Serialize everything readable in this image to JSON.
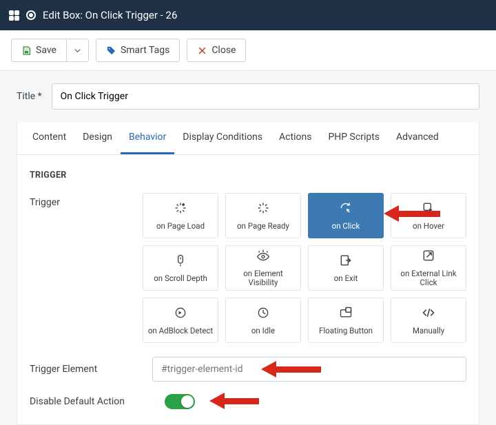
{
  "topbar": {
    "title": "Edit Box: On Click Trigger - 26"
  },
  "toolbar": {
    "save": "Save",
    "smartTags": "Smart Tags",
    "close": "Close"
  },
  "title": {
    "label": "Title *",
    "value": "On Click Trigger"
  },
  "tabs": [
    "Content",
    "Design",
    "Behavior",
    "Display Conditions",
    "Actions",
    "PHP Scripts",
    "Advanced"
  ],
  "activeTab": 2,
  "section": {
    "heading": "Trigger"
  },
  "trigger": {
    "label": "Trigger",
    "options": [
      "on Page Load",
      "on Page Ready",
      "on Click",
      "on Hover",
      "on Scroll Depth",
      "on Element Visibility",
      "on Exit",
      "on External Link Click",
      "on AdBlock Detect",
      "on Idle",
      "Floating Button",
      "Manually"
    ],
    "selectedIndex": 2
  },
  "triggerElement": {
    "label": "Trigger Element",
    "placeholder": "#trigger-element-id"
  },
  "disableDefault": {
    "label": "Disable Default Action",
    "value": true
  },
  "icons": {
    "pageLoad": "<svg viewBox='0 0 24 24' fill='none' stroke='currentColor' stroke-width='1.7'><line x1='12' y1='3' x2='12' y2='7'/><line x1='12' y1='17' x2='12' y2='21'/><line x1='3' y1='12' x2='7' y2='12'/><line x1='17' y1='12' x2='21' y2='12'/><line x1='5.6' y1='5.6' x2='8.3' y2='8.3'/><line x1='15.7' y1='15.7' x2='18.4' y2='18.4'/><line x1='5.6' y1='18.4' x2='8.3' y2='15.7'/><line x1='15.7' y1='8.3' x2='18.4' y2='5.6'/><circle cx='17' cy='6' r='2.2' fill='currentColor' stroke='none'/></svg>",
    "pageReady": "<svg viewBox='0 0 24 24' fill='none' stroke='currentColor' stroke-width='1.7'><line x1='12' y1='3' x2='12' y2='7'/><line x1='12' y1='17' x2='12' y2='21'/><line x1='3' y1='12' x2='7' y2='12'/><line x1='17' y1='12' x2='21' y2='12'/><line x1='5.6' y1='5.6' x2='8.3' y2='8.3'/><line x1='15.7' y1='15.7' x2='18.4' y2='18.4'/><line x1='5.6' y1='18.4' x2='8.3' y2='15.7'/><line x1='15.7' y1='8.3' x2='18.4' y2='5.6'/></svg>",
    "click": "<svg viewBox='0 0 24 24' fill='none' stroke='currentColor' stroke-width='1.7'><path d='M4 12a8 8 0 0 1 14-5'/><polyline points='18 3 18 7 14 7'/><path d='M13 13 l6 2 -2 1 2 3 -1.5 1 -2 -3 -1.5 2 z' fill='currentColor' stroke='none'/></svg>",
    "hover": "<svg viewBox='0 0 24 24' fill='none' stroke='currentColor' stroke-width='1.7'><rect x='4' y='4' width='12' height='12' rx='2'/><path d='M13 13 l6 2 -2 1 2 3 -1.5 1 -2 -3 -1.5 2 z' fill='currentColor' stroke='none'/></svg>",
    "scroll": "<svg viewBox='0 0 24 24' fill='none' stroke='currentColor' stroke-width='1.6'><rect x='8' y='3' width='8' height='14' rx='4'/><line x1='12' y1='7' x2='12' y2='10'/><line x1='12' y1='19' x2='12' y2='22'/></svg>",
    "visibility": "<svg viewBox='0 0 24 24' fill='none' stroke='currentColor' stroke-width='1.6'><path d='M2 14s3.5-6 10-6 10 6 10 6-3.5 6-10 6-10-6-10-6z'/><circle cx='12' cy='14' r='2.4'/><line x1='5' y1='4' x2='5' y2='7'/><line x1='12' y1='2' x2='12' y2='6'/><line x1='19' y1='4' x2='19' y2='7'/></svg>",
    "exit": "<svg viewBox='0 0 24 24' fill='none' stroke='currentColor' stroke-width='1.7'><rect x='4' y='4' width='12' height='16' rx='1'/><path d='M12 12h8'/><polyline points='17 9 20 12 17 15'/></svg>",
    "external": "<svg viewBox='0 0 24 24' fill='none' stroke='currentColor' stroke-width='1.7'><rect x='4' y='4' width='16' height='16' rx='2'/><polyline points='12 7 17 7 17 12'/><line x1='17' y1='7' x2='9' y2='15'/></svg>",
    "adblock": "<svg viewBox='0 0 24 24' fill='none' stroke='currentColor' stroke-width='1.6'><circle cx='12' cy='12' r='8'/><path d='M9 15V9l5 3z' fill='currentColor' stroke='none'/></svg>",
    "idle": "<svg viewBox='0 0 24 24' fill='none' stroke='currentColor' stroke-width='1.6'><circle cx='12' cy='12' r='8'/><polyline points='12 7 12 12 16 14'/></svg>",
    "floating": "<svg viewBox='0 0 24 24' fill='none' stroke='currentColor' stroke-width='1.6'><rect x='3' y='7' width='18' height='12' rx='2'/><rect x='12' y='3' width='9' height='8' rx='1' fill='#fff'/><rect x='12' y='3' width='9' height='8' rx='1'/></svg>",
    "manually": "<svg viewBox='0 0 24 24' fill='none' stroke='currentColor' stroke-width='1.9'><polyline points='8 7 3 12 8 17'/><polyline points='16 7 21 12 16 17'/><line x1='14' y1='5' x2='10' y2='19'/></svg>"
  }
}
